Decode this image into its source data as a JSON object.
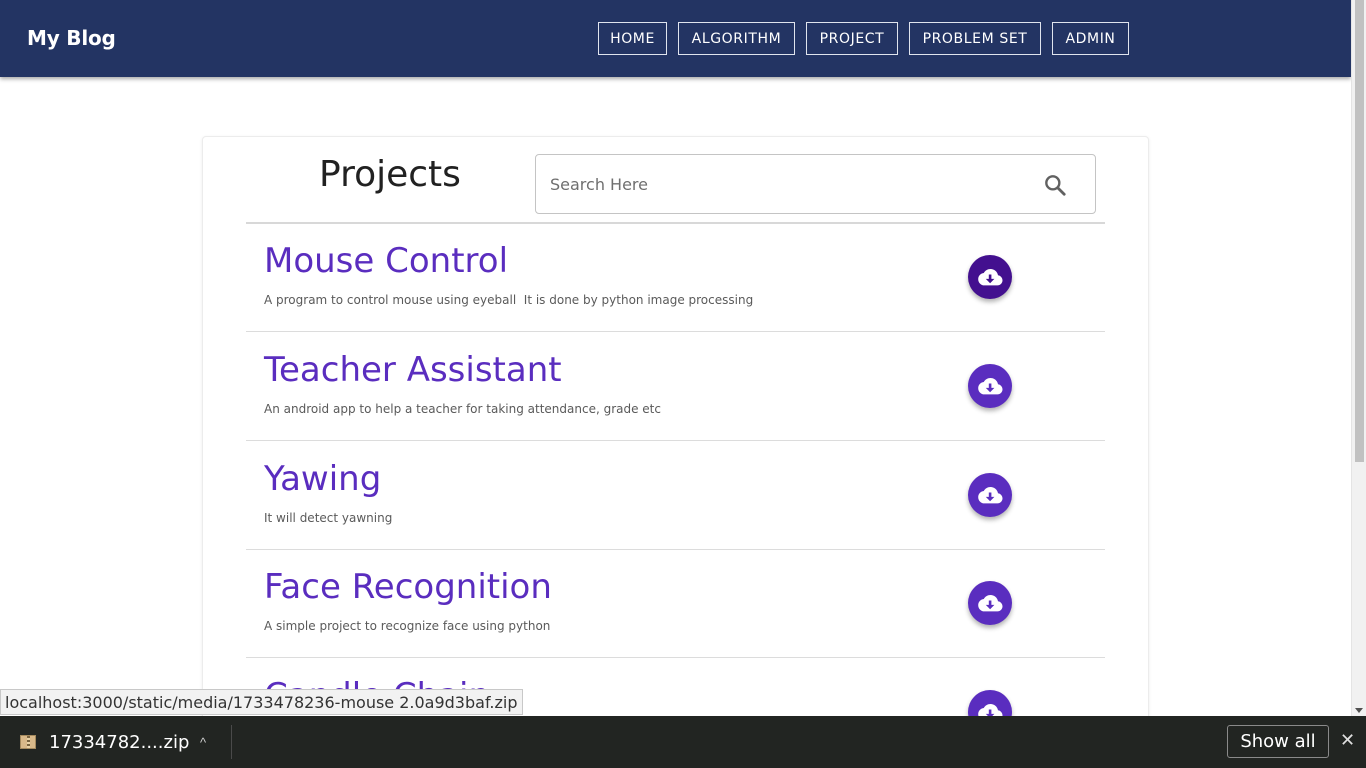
{
  "navbar": {
    "brand": "My Blog",
    "items": [
      {
        "label": "HOME"
      },
      {
        "label": "ALGORITHM"
      },
      {
        "label": "PROJECT"
      },
      {
        "label": "PROBLEM SET"
      },
      {
        "label": "ADMIN"
      }
    ]
  },
  "page": {
    "title": "Projects",
    "search": {
      "placeholder": "Search Here",
      "value": ""
    }
  },
  "projects": [
    {
      "title": "Mouse Control",
      "description": "A program to control mouse using eyeball  It is done by python image processing",
      "download_icon": "cloud-download-icon"
    },
    {
      "title": "Teacher Assistant",
      "description": "An android app to help a teacher for taking attendance, grade etc",
      "download_icon": "cloud-download-icon"
    },
    {
      "title": "Yawing",
      "description": "It will detect yawning",
      "download_icon": "cloud-download-icon"
    },
    {
      "title": "Face Recognition",
      "description": "A simple project to recognize face using python",
      "download_icon": "cloud-download-icon"
    },
    {
      "title": "Candle Chain",
      "description": "",
      "download_icon": "cloud-download-icon"
    }
  ],
  "status_bar": {
    "url": "localhost:3000/static/media/1733478236-mouse 2.0a9d3baf.zip"
  },
  "download_shelf": {
    "filename": "17334782....zip",
    "show_all_label": "Show all",
    "close_label": "✕",
    "chevron_label": "^"
  },
  "colors": {
    "navbar_bg": "#233463",
    "accent": "#5a2dbf",
    "accent_active": "#43108f",
    "shelf_bg": "#222522"
  }
}
